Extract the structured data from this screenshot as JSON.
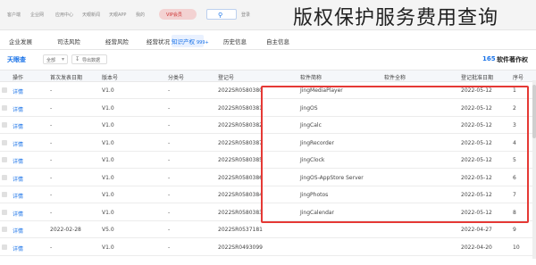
{
  "caption": "版权保护服务费用查询",
  "header": {
    "vip_label": "VIP会员",
    "top_items": [
      "客户端",
      "企业网",
      "应用中心",
      "天眼新闻",
      "天眼APP",
      "我的",
      "登录"
    ]
  },
  "nav": {
    "tabs": [
      "企业发展",
      "司法风险",
      "经营风险",
      "经营状况",
      "知识产权",
      "历史信息",
      "自主信息"
    ],
    "active_index": 4,
    "active_badge": "999+"
  },
  "toolbar": {
    "title": "软件著作权",
    "count": "165",
    "export_label": "导出数据",
    "filter_label": "全部",
    "logo_text": "天眼查"
  },
  "table": {
    "columns": [
      "序号",
      "登记批准日期",
      "软件全称",
      "软件简称",
      "登记号",
      "分类号",
      "版本号",
      "首次发表日期",
      "操作"
    ],
    "rows": [
      {
        "no": "1",
        "date": "2022-05-12",
        "full": "",
        "short": "JingMediaPlayer",
        "reg": "2022SR0580380",
        "cls": "-",
        "ver": "V1.0",
        "pub": "-",
        "op": "详情"
      },
      {
        "no": "2",
        "date": "2022-05-12",
        "full": "",
        "short": "JingOS",
        "reg": "2022SR0580381",
        "cls": "-",
        "ver": "V1.0",
        "pub": "-",
        "op": "详情"
      },
      {
        "no": "3",
        "date": "2022-05-12",
        "full": "",
        "short": "JingCalc",
        "reg": "2022SR0580382",
        "cls": "-",
        "ver": "V1.0",
        "pub": "-",
        "op": "详情"
      },
      {
        "no": "4",
        "date": "2022-05-12",
        "full": "",
        "short": "JingRecorder",
        "reg": "2022SR0580387",
        "cls": "-",
        "ver": "V1.0",
        "pub": "-",
        "op": "详情"
      },
      {
        "no": "5",
        "date": "2022-05-12",
        "full": "",
        "short": "JingClock",
        "reg": "2022SR0580385",
        "cls": "-",
        "ver": "V1.0",
        "pub": "-",
        "op": "详情"
      },
      {
        "no": "6",
        "date": "2022-05-12",
        "full": "",
        "short": "JingOS-AppStore Server",
        "reg": "2022SR0580386",
        "cls": "-",
        "ver": "V1.0",
        "pub": "-",
        "op": "详情"
      },
      {
        "no": "7",
        "date": "2022-05-12",
        "full": "",
        "short": "JingPhotos",
        "reg": "2022SR0580384",
        "cls": "-",
        "ver": "V1.0",
        "pub": "-",
        "op": "详情"
      },
      {
        "no": "8",
        "date": "2022-05-12",
        "full": "",
        "short": "JingCalendar",
        "reg": "2022SR0580383",
        "cls": "-",
        "ver": "V1.0",
        "pub": "-",
        "op": "详情"
      },
      {
        "no": "9",
        "date": "2022-04-27",
        "full": "",
        "short": "",
        "reg": "2022SR0537181",
        "cls": "-",
        "ver": "V5.0",
        "pub": "2022-02-28",
        "op": "详情"
      },
      {
        "no": "10",
        "date": "2022-04-20",
        "full": "",
        "short": "",
        "reg": "2022SR0493099",
        "cls": "-",
        "ver": "V1.0",
        "pub": "-",
        "op": "详情"
      }
    ]
  },
  "colors": {
    "accent": "#1a73e8",
    "highlight_border": "#e53935"
  }
}
